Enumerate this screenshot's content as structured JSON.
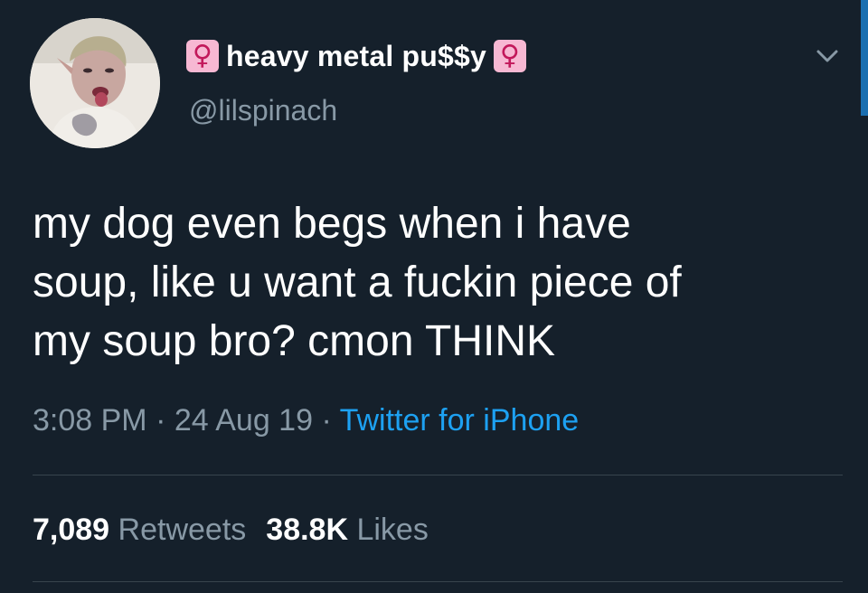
{
  "user": {
    "display_name": "heavy metal pu$$y",
    "name_emoji": "♀",
    "handle": "@lilspinach"
  },
  "tweet": {
    "lines": [
      "my dog even begs when i have",
      "soup, like u want a fuckin piece of",
      "my soup bro? cmon THINK"
    ]
  },
  "meta": {
    "time": "3:08 PM",
    "separator": " · ",
    "date": "24 Aug 19",
    "source": "Twitter for iPhone"
  },
  "stats": {
    "retweets_count": "7,089",
    "retweets_label": "Retweets",
    "likes_count": "38.8K",
    "likes_label": "Likes"
  },
  "icons": {
    "caret": "chevron-down-icon"
  },
  "colors": {
    "background": "#15202b",
    "secondary_text": "#8899a6",
    "link": "#1da1f2",
    "divider": "#38444d"
  }
}
